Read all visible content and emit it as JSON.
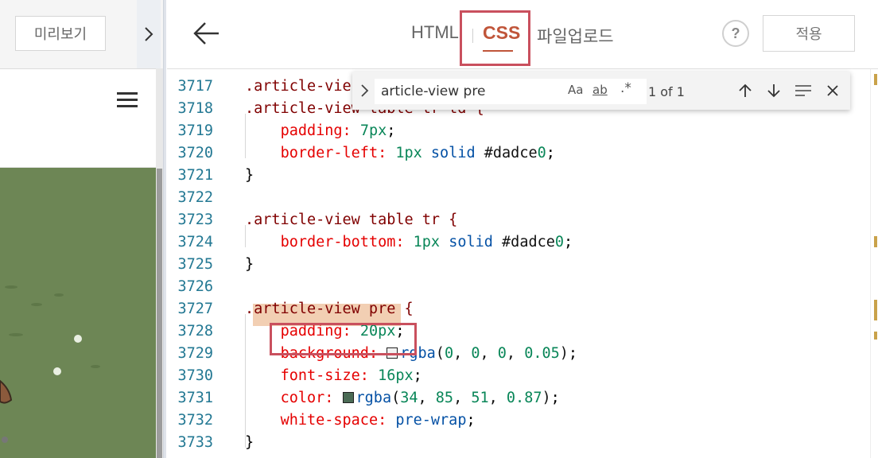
{
  "left_panel": {
    "preview_label": "미리보기",
    "expand_icon": "chevron-right-icon",
    "menu_icon": "hamburger-menu-icon"
  },
  "header": {
    "back_icon": "arrow-left-icon",
    "tabs": [
      {
        "label": "HTML",
        "active": false
      },
      {
        "label": "CSS",
        "active": true
      },
      {
        "label": "파일업로드",
        "active": false
      }
    ],
    "help_label": "?",
    "apply_label": "적용"
  },
  "find": {
    "query": "article-view pre",
    "match_case": "Aa",
    "whole_word": "ab",
    "regex": ".*",
    "count": "1 of 1",
    "icons": [
      "arrow-up-icon",
      "arrow-down-icon",
      "find-in-selection-icon",
      "close-icon"
    ]
  },
  "code": {
    "lines": [
      {
        "n": "3717",
        "t": ".article-vie"
      },
      {
        "n": "3718",
        "t": ".article-view table tr td {"
      },
      {
        "n": "3719",
        "t": "    padding: 7px;"
      },
      {
        "n": "3720",
        "t": "    border-left: 1px solid #dadce0;"
      },
      {
        "n": "3721",
        "t": "}"
      },
      {
        "n": "3722",
        "t": ""
      },
      {
        "n": "3723",
        "t": ".article-view table tr {"
      },
      {
        "n": "3724",
        "t": "    border-bottom: 1px solid #dadce0;"
      },
      {
        "n": "3725",
        "t": "}"
      },
      {
        "n": "3726",
        "t": ""
      },
      {
        "n": "3727",
        "t": ".article-view pre {"
      },
      {
        "n": "3728",
        "t": "    padding: 20px;"
      },
      {
        "n": "3729",
        "t": "    background: rgba(0, 0, 0, 0.05);"
      },
      {
        "n": "3730",
        "t": "    font-size: 16px;"
      },
      {
        "n": "3731",
        "t": "    color: rgba(34, 85, 51, 0.87);"
      },
      {
        "n": "3732",
        "t": "    white-space: pre-wrap;"
      },
      {
        "n": "3733",
        "t": "}"
      }
    ]
  },
  "colors": {
    "accent": "#c0553a",
    "annotation": "#c9505e",
    "swatch_border": "#dadce0",
    "swatch_background": "#f2f2f2",
    "swatch_color": "#4b6b55"
  }
}
